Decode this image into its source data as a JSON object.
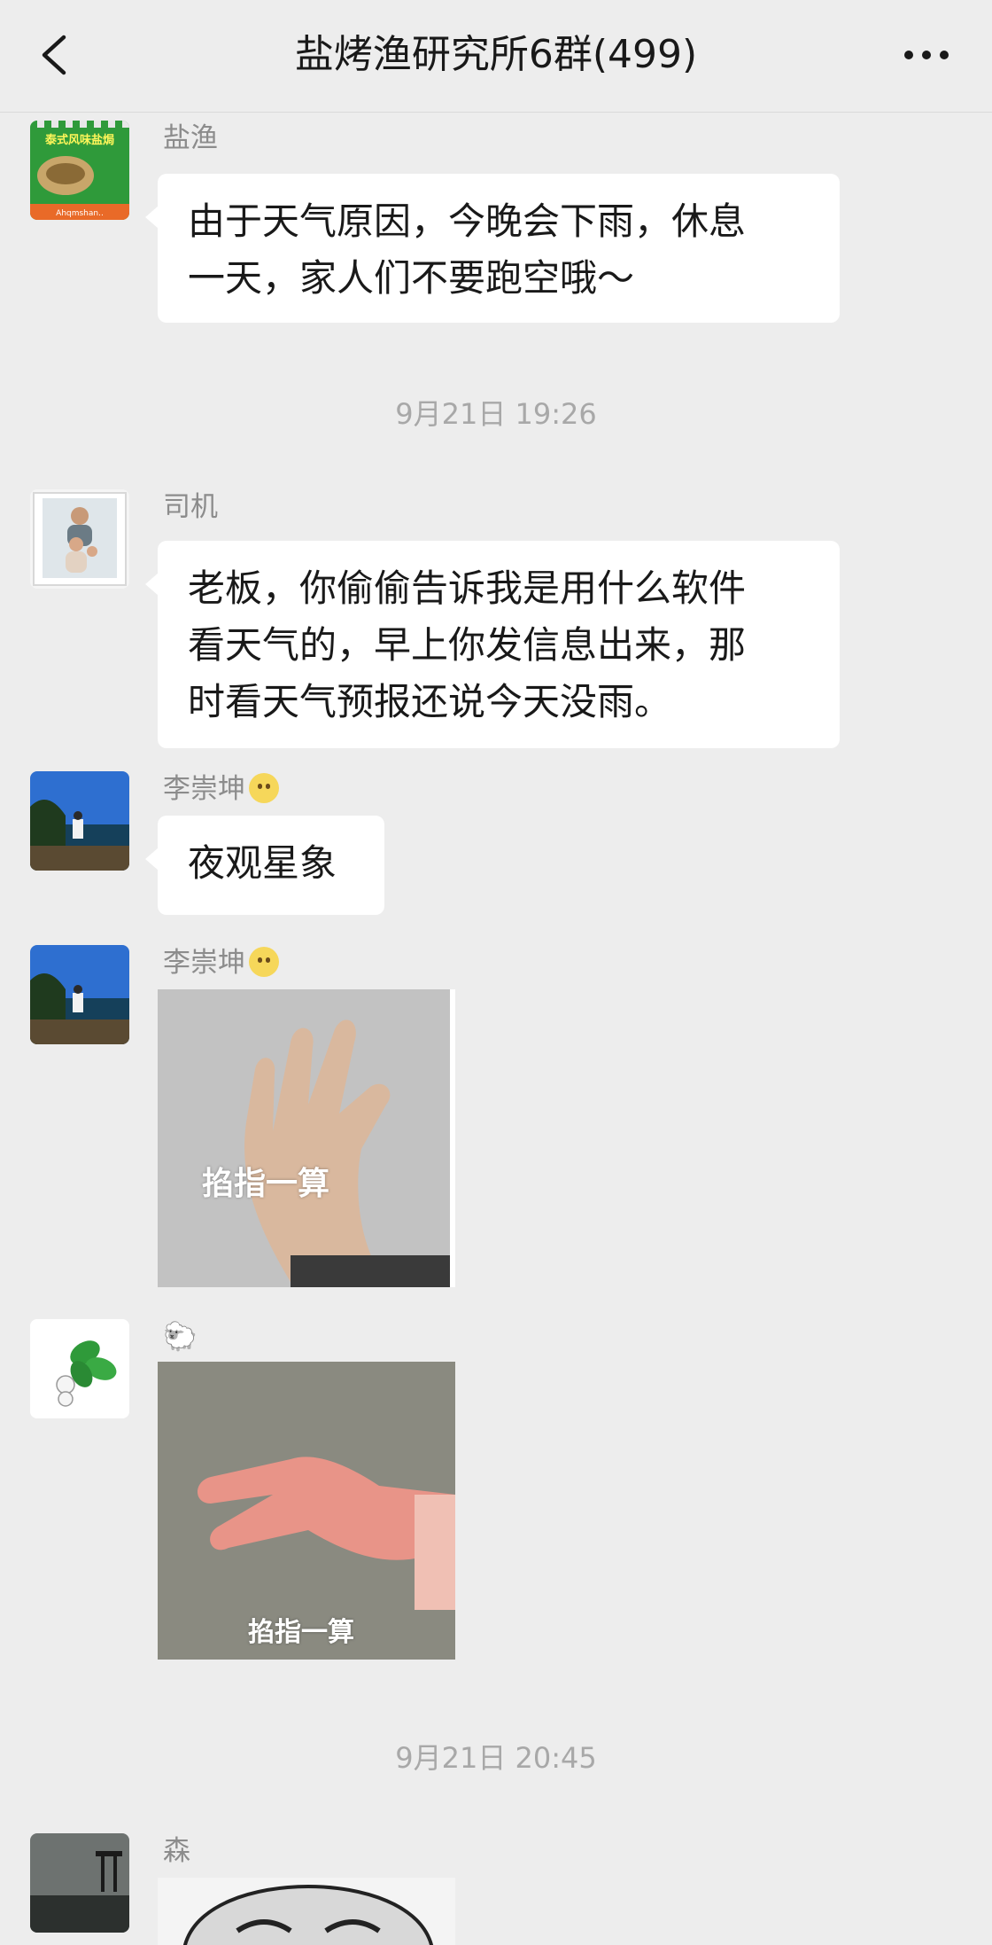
{
  "header": {
    "title": "盐烤渔研究所6群(499)",
    "back_icon": "chevron-left-icon",
    "more_icon": "more-dots-icon"
  },
  "messages": [
    {
      "sender": "盐渔",
      "avatar": "shop-logo-avatar",
      "avatar_text": [
        "泰式风味盐焗",
        "Ahqmshan.."
      ],
      "lines": [
        "由于天气原因，今晚会下雨，休息",
        "一天，家人们不要跑空哦～"
      ]
    },
    {
      "timestamp": "9月21日 19:26"
    },
    {
      "sender": "司机",
      "avatar": "family-photo-avatar",
      "lines": [
        "老板，你偷偷告诉我是用什么软件",
        "看天气的，早上你发信息出来，那",
        "时看天气预报还说今天没雨。"
      ]
    },
    {
      "sender": "李崇坤",
      "sender_emoji": "smiley-emoji-icon",
      "avatar": "seaside-person-avatar",
      "lines": [
        "夜观星象"
      ]
    },
    {
      "sender": "李崇坤",
      "sender_emoji": "smiley-emoji-icon",
      "avatar": "seaside-person-avatar",
      "sticker_caption": "掐指一算"
    },
    {
      "sender": "🐑",
      "avatar": "green-leaves-avatar",
      "sticker_caption": "掐指一算"
    },
    {
      "timestamp": "9月21日 20:45"
    },
    {
      "sender": "森",
      "avatar": "dark-landscape-avatar"
    }
  ],
  "colors": {
    "background": "#ededed",
    "bubble": "#ffffff",
    "sender_text": "#8c8c8c",
    "timestamp_text": "#a8a8a8",
    "message_text": "#191919"
  }
}
